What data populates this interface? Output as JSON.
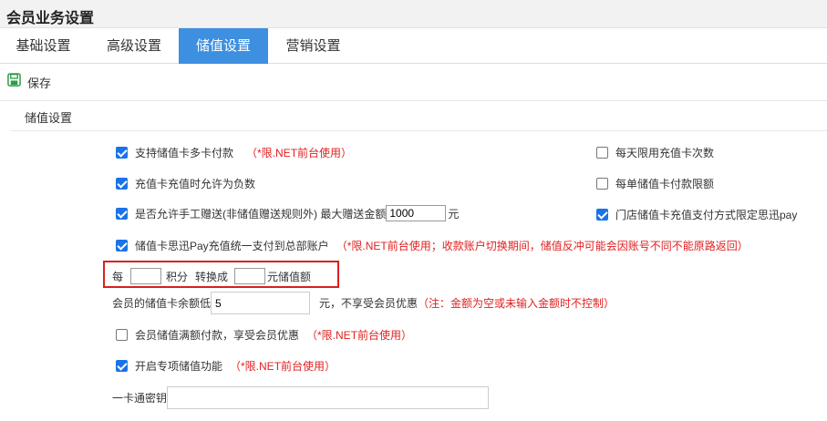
{
  "window": {
    "title": "会员业务设置"
  },
  "tabs": [
    {
      "label": "基础设置",
      "active": false
    },
    {
      "label": "高级设置",
      "active": false
    },
    {
      "label": "储值设置",
      "active": true
    },
    {
      "label": "营销设置",
      "active": false
    }
  ],
  "toolbar": {
    "save_label": "保存",
    "save_icon": "floppy-disk-icon"
  },
  "section": {
    "title": "储值设置"
  },
  "options": {
    "multi_card_pay": {
      "label": "支持储值卡多卡付款",
      "note": "（*限.NET前台使用）",
      "checked": true
    },
    "daily_limit": {
      "label": "每天限用充值卡次数",
      "checked": false
    },
    "allow_negative": {
      "label": "充值卡充值时允许为负数",
      "checked": true
    },
    "single_limit": {
      "label": "每单储值卡付款限额",
      "checked": false
    },
    "manual_gift": {
      "label": "是否允许手工赠送(非储值赠送规则外) 最大赠送金额",
      "value": "1000",
      "unit": "元",
      "checked": true
    },
    "store_pay_limit": {
      "label": "门店储值卡充值支付方式限定思迅pay",
      "checked": true
    },
    "siyun_pay": {
      "label": "储值卡思迅Pay充值统一支付到总部账户",
      "note": "（*限.NET前台使用；收款账户切换期间，储值反冲可能会因账号不同不能原路返回）",
      "checked": true
    }
  },
  "points_convert": {
    "prefix": "每",
    "points_value": "",
    "mid": "积分",
    "convert": "转换成",
    "amount_value": "",
    "suffix": "元储值额"
  },
  "balance_threshold": {
    "label": "会员的储值卡余额低",
    "value": "5",
    "suffix": "元，不享受会员优惠",
    "note": "（注：金额为空或未输入金额时不控制）"
  },
  "full_pay_discount": {
    "label": "会员储值满额付款，享受会员优惠",
    "note": "（*限.NET前台使用）",
    "checked": false
  },
  "special_stored_value": {
    "label": "开启专项储值功能",
    "note": "（*限.NET前台使用）",
    "checked": true
  },
  "one_card_key": {
    "label": "一卡通密钥",
    "value": ""
  },
  "colors": {
    "accent": "#3d8fe0",
    "note_red": "#e02020",
    "highlight_box": "#d9201c",
    "save_icon": "#2e9b4a"
  }
}
